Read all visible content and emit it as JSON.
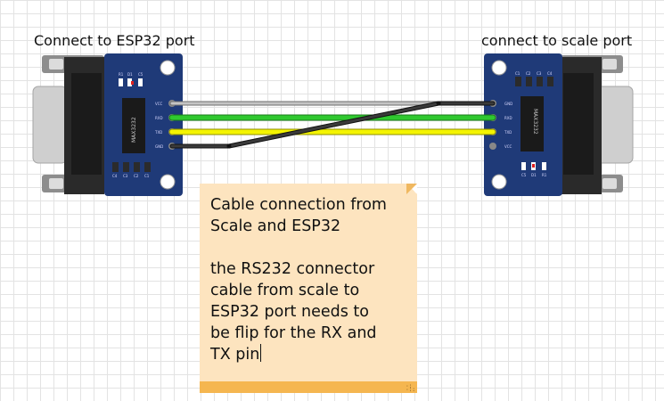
{
  "titles": {
    "left": "Connect to ESP32 port",
    "right": "connect to scale port"
  },
  "left_module": {
    "chip_label": "MAX3232",
    "pins": [
      "VCC",
      "RXD",
      "TXD",
      "GND"
    ],
    "capacitors": [
      "C4",
      "C3",
      "C2",
      "C1"
    ],
    "top_labels": [
      "R1",
      "D1",
      "C5"
    ]
  },
  "right_module": {
    "chip_label": "MAX3232",
    "pins": [
      "GND",
      "RXD",
      "TXD",
      "VCC"
    ],
    "capacitors": [
      "C1",
      "C2",
      "C3",
      "C4"
    ],
    "bottom_labels": [
      "C5",
      "D1",
      "R1"
    ]
  },
  "wires": [
    {
      "from": "GND (ESP32 side)",
      "to": "GND (scale side)",
      "color": "#222222"
    },
    {
      "from": "RXD",
      "to": "RXD",
      "color": "#2db82d"
    },
    {
      "from": "TXD",
      "to": "TXD",
      "color": "#f2f200"
    },
    {
      "from": "VCC (ESP32 side)",
      "to": "GND (scale side)",
      "color": "#9a9a9a"
    }
  ],
  "note": {
    "heading": "Cable connection from\nScale and ESP32",
    "body": "the RS232 connector\ncable from scale to\nESP32 port needs to\nbe flip for the RX and\nTX pin"
  }
}
